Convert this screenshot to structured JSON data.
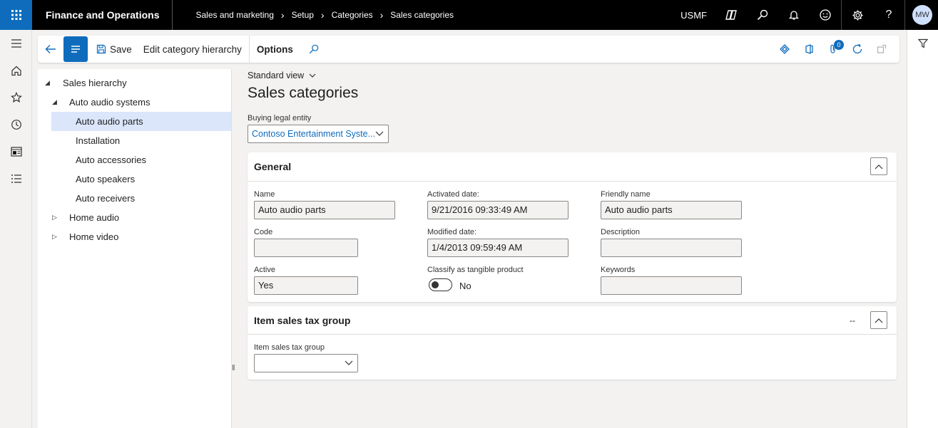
{
  "app": {
    "title": "Finance and Operations"
  },
  "breadcrumb": [
    "Sales and marketing",
    "Setup",
    "Categories",
    "Sales categories"
  ],
  "topbar": {
    "company": "USMF",
    "avatar_initials": "MW"
  },
  "actionpane": {
    "save_label": "Save",
    "edit_label": "Edit category hierarchy",
    "options_label": "Options",
    "attachments_count": "0"
  },
  "tree": {
    "root": "Sales hierarchy",
    "auto_audio_systems": "Auto audio systems",
    "children": [
      "Auto audio parts",
      "Installation",
      "Auto accessories",
      "Auto speakers",
      "Auto receivers"
    ],
    "home_audio": "Home audio",
    "home_video": "Home video"
  },
  "page": {
    "view": "Standard view",
    "title": "Sales categories",
    "buying_entity_label": "Buying legal entity",
    "buying_entity_value": "Contoso Entertainment Syste..."
  },
  "general": {
    "title": "General",
    "name_label": "Name",
    "name_value": "Auto audio parts",
    "activated_label": "Activated date:",
    "activated_value": "9/21/2016 09:33:49 AM",
    "friendly_label": "Friendly name",
    "friendly_value": "Auto audio parts",
    "code_label": "Code",
    "code_value": "",
    "modified_label": "Modified date:",
    "modified_value": "1/4/2013 09:59:49 AM",
    "description_label": "Description",
    "description_value": "",
    "active_label": "Active",
    "active_value": "Yes",
    "tangible_label": "Classify as tangible product",
    "tangible_value": "No",
    "keywords_label": "Keywords",
    "keywords_value": ""
  },
  "tax": {
    "title": "Item sales tax group",
    "summary": "--",
    "group_label": "Item sales tax group",
    "group_value": ""
  },
  "colors": {
    "accent": "#0f6cbd",
    "topbar": "#000000",
    "selected_row": "#dbe6fb"
  }
}
